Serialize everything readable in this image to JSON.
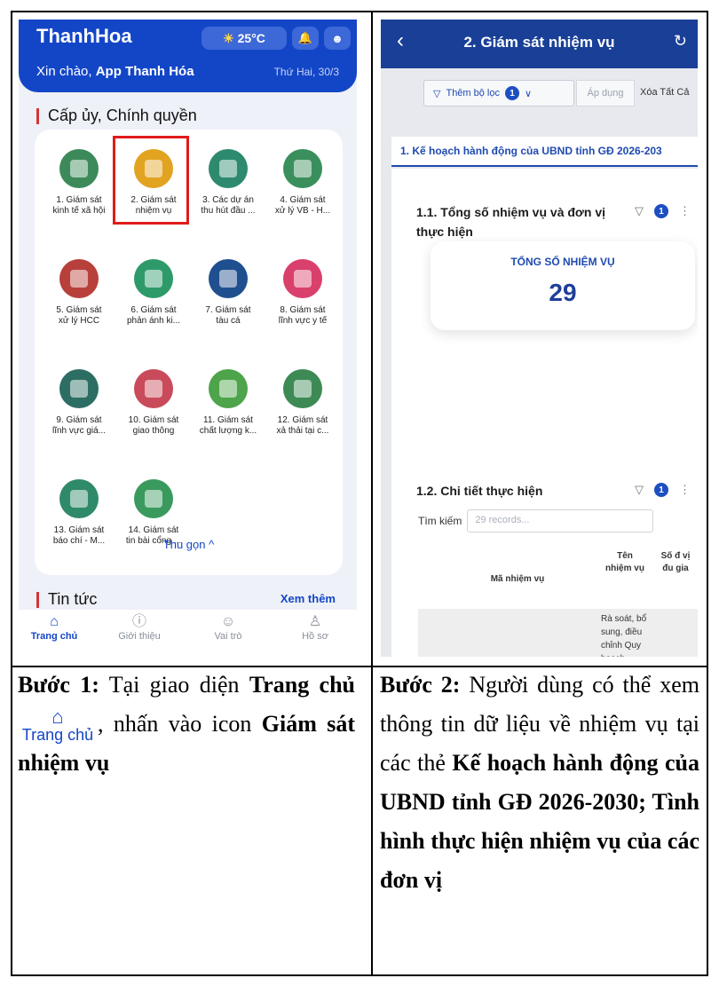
{
  "left": {
    "app_name": "ThanhHoa",
    "weather": "25°C",
    "greeting_prefix": "Xin chào,",
    "greeting_name": "App Thanh Hóa",
    "date": "Thứ Hai, 30/3",
    "section_title": "Cấp ủy, Chính quyền",
    "tiles": [
      {
        "label": "1. Giám sát\nkinh tế xã hội",
        "icon": "growth-chart-icon",
        "color": "#3c8a5a"
      },
      {
        "label": "2. Giám sát\nnhiệm vụ",
        "icon": "coin-target-icon",
        "color": "#e2a321"
      },
      {
        "label": "3. Các dự án\nthu hút đầu ...",
        "icon": "money-hand-icon",
        "color": "#2d8a6e"
      },
      {
        "label": "4. Giám sát\nxử lý VB - H...",
        "icon": "document-tray-icon",
        "color": "#3a8f5c"
      },
      {
        "label": "5. Giám sát\nxử lý HCC",
        "icon": "recycle-icon",
        "color": "#b8403b"
      },
      {
        "label": "6. Giám sát\nphản ánh ki...",
        "icon": "envelope-icon",
        "color": "#2e9a6a"
      },
      {
        "label": "7. Giám sát\ntàu cá",
        "icon": "ship-icon",
        "color": "#1f4f8f"
      },
      {
        "label": "8. Giám sát\nlĩnh vực y tế",
        "icon": "heartbeat-icon",
        "color": "#d9406b"
      },
      {
        "label": "9. Giám sát\nlĩnh vực giá...",
        "icon": "graduation-cap-icon",
        "color": "#2c6e63"
      },
      {
        "label": "10. Giám sát\ngiao thông",
        "icon": "traffic-camera-icon",
        "color": "#c94a5a"
      },
      {
        "label": "11. Giám sát\nchất lượng k...",
        "icon": "globe-leaf-icon",
        "color": "#4da44a"
      },
      {
        "label": "12. Giám sát\nxả thải tại c...",
        "icon": "factory-icon",
        "color": "#3d8a55"
      },
      {
        "label": "13. Giám sát\nbáo chí - M...",
        "icon": "newspaper-icon",
        "color": "#2f8a6a"
      },
      {
        "label": "14. Giám sát\ntin bài cổng ...",
        "icon": "monitor-search-icon",
        "color": "#3a9a5e"
      }
    ],
    "collapse_label": "Thu gọn ^",
    "news_title": "Tin tức",
    "see_more": "Xem thêm",
    "nav": [
      {
        "label": "Trang chủ",
        "icon": "home-icon",
        "glyph": "⌂"
      },
      {
        "label": "Giới thiệu",
        "icon": "info-icon",
        "glyph": "ⓘ"
      },
      {
        "label": "Vai trò",
        "icon": "role-icon",
        "glyph": "☺"
      },
      {
        "label": "Hồ sơ",
        "icon": "profile-icon",
        "glyph": "♙"
      }
    ]
  },
  "right": {
    "title": "2. Giám sát nhiệm vụ",
    "add_filter": "Thêm bộ lọc",
    "filter_count": "1",
    "apply": "Áp dụng",
    "clear_all": "Xóa Tất Cả",
    "tab": "1. Kế hoạch hành động của UBND tỉnh GĐ 2026-203",
    "card1_title": "1.1. Tổng số nhiệm vụ và đơn vị thực hiện",
    "card_badge": "1",
    "kpi_label": "TỔNG SỐ NHIỆM VỤ",
    "kpi_value": "29",
    "card2_title": "1.2. Chi tiết thực hiện",
    "search_label": "Tìm kiếm",
    "search_placeholder": "29 records...",
    "col_code": "Mã nhiệm vụ",
    "col_name": "Tên nhiệm vụ",
    "col_units": "Số đ vị đu gia",
    "row_name": "Rà soát, bổ sung, điều chỉnh Quy hoạch"
  },
  "text": {
    "step1_label": "Bước 1:",
    "step1_a": "Tại giao diện",
    "step1_home": "Trang chủ",
    "step1_home_icon": "Trang chủ",
    "step1_b": ", nhấn vào icon",
    "step1_target": "Giám sát nhiệm vụ",
    "step2_label": "Bước 2:",
    "step2_a": "Người dùng có thể xem thông tin dữ liệu về nhiệm vụ tại các thẻ",
    "step2_bold": "Kế hoạch hành động của UBND tỉnh GĐ 2026-2030; Tình hình thực hiện nhiệm vụ của các đơn vị"
  }
}
